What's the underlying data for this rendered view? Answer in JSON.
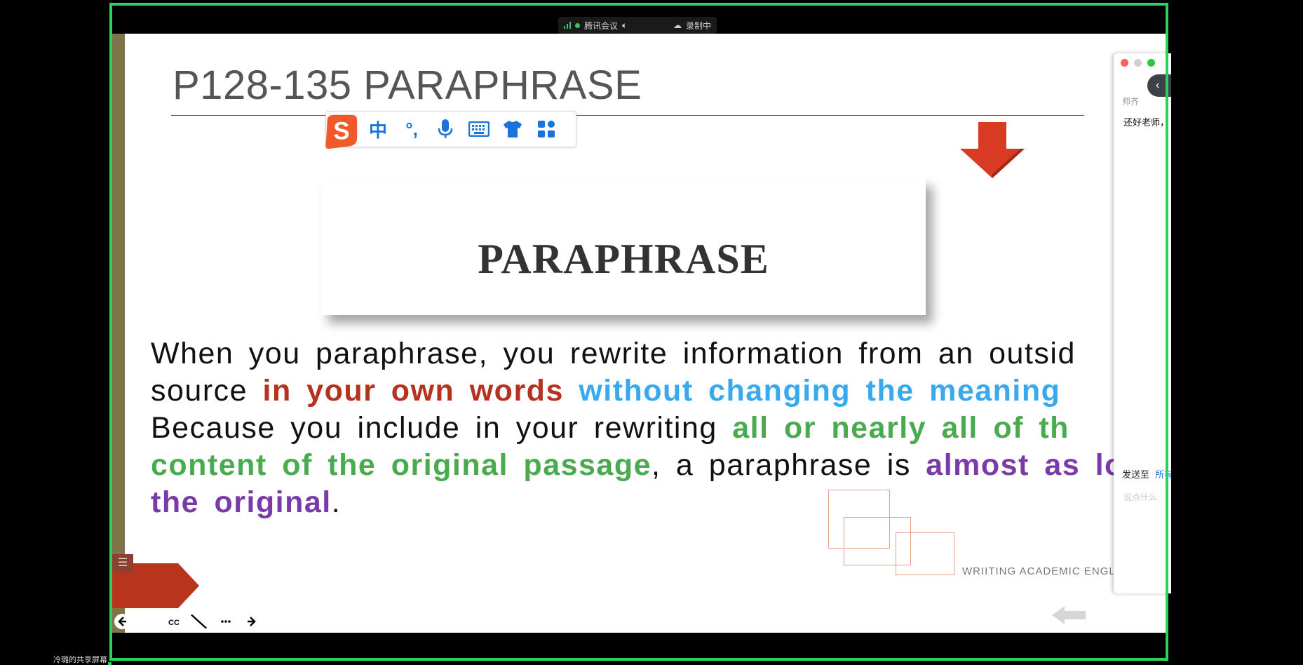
{
  "meeting_bar": {
    "app_name": "腾讯会议",
    "recording_label": "录制中"
  },
  "slide": {
    "title": "P128-135 PARAPHRASE",
    "card_title": "PARAPHRASE",
    "body": {
      "line1": "When you paraphrase, you rewrite information from an outsid",
      "line2_prefix": "source ",
      "line2_red": "in your own words",
      "line2_mid": " ",
      "line2_blue": "without changing the meaning",
      "line3_prefix": "Because you include in your rewriting ",
      "line3_green": "all or nearly all of th",
      "line4_green": "content of the original passage",
      "line4_mid": ", a paraphrase is ",
      "line4_purple": "almost as long a",
      "line5_purple": "the original",
      "line5_suffix": "."
    },
    "footer": "WRIITING ACADEMIC ENGLIS"
  },
  "ime_toolbar": {
    "lang_label": "中",
    "punct_label": "°,"
  },
  "chat": {
    "sender": "师齐",
    "message": "还好老师，",
    "send_to_label": "发送至",
    "send_to_target": "所有",
    "input_placeholder": "说点什么"
  },
  "share_label": "冷璐的共享屏幕",
  "colors": {
    "frame": "#2bd25a",
    "red": "#b5321f",
    "blue": "#39a9ef",
    "green": "#4aaa4e",
    "purple": "#7a3aa8"
  },
  "icons": [
    "signal-icon",
    "speaker-icon",
    "cloud-record-icon",
    "sogou-logo-icon",
    "mic-icon",
    "keyboard-icon",
    "shirt-icon",
    "grid-icon",
    "down-arrow-icon",
    "back-icon",
    "pen-icon",
    "cc-icon",
    "video-off-icon",
    "more-icon",
    "forward-icon"
  ]
}
